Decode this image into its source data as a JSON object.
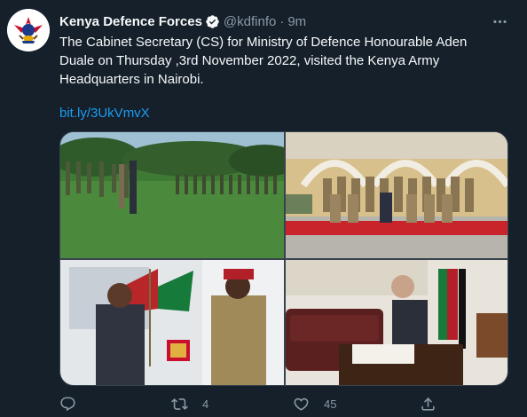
{
  "tweet": {
    "author": {
      "display_name": "Kenya Defence Forces",
      "handle": "@kdfinfo",
      "verified": true,
      "avatar_icon": "kdf-emblem-icon"
    },
    "separator": "·",
    "timestamp": "9m",
    "text": "The Cabinet Secretary (CS) for Ministry of Defence Honourable Aden Duale on Thursday ,3rd November 2022, visited the Kenya Army Headquarters in Nairobi.",
    "link": "bit.ly/3UkVmvX",
    "media": {
      "photos": [
        {
          "name": "photo-parade-ground",
          "description": "Officials walking past soldiers lined up on a grass field"
        },
        {
          "name": "photo-group-portrait",
          "description": "Group portrait of officers in front of a yellow building with a red carpet"
        },
        {
          "name": "photo-plaque-presentation",
          "description": "CS receiving a plaque from an army general in front of flags"
        },
        {
          "name": "photo-signing-book",
          "description": "CS signing the visitors book at a desk beside the Kenya flag"
        }
      ]
    },
    "actions": {
      "reply": {
        "icon": "reply-icon",
        "count": ""
      },
      "retweet": {
        "icon": "retweet-icon",
        "count": "4"
      },
      "like": {
        "icon": "heart-icon",
        "count": "45"
      },
      "share": {
        "icon": "share-icon",
        "count": ""
      }
    }
  },
  "colors": {
    "background": "#15202b",
    "text_primary": "#f7f9f9",
    "text_secondary": "#8b98a5",
    "link": "#1d9bf0",
    "verified": "#1d9bf0"
  }
}
